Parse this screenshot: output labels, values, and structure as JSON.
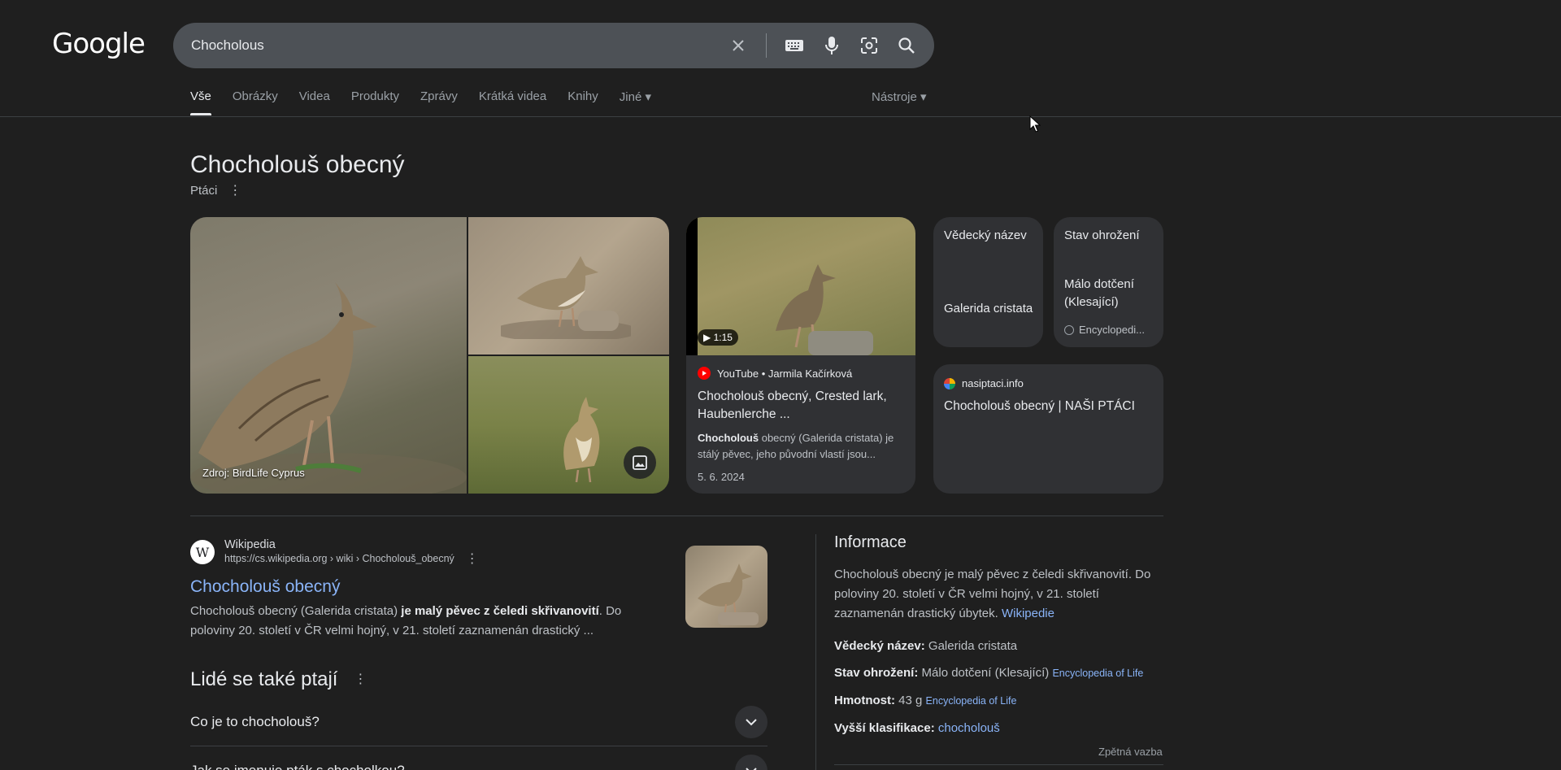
{
  "logo": "Google",
  "search": {
    "value": "Chocholous"
  },
  "tabs": [
    {
      "label": "Vše"
    },
    {
      "label": "Obrázky"
    },
    {
      "label": "Videa"
    },
    {
      "label": "Produkty"
    },
    {
      "label": "Zprávy"
    },
    {
      "label": "Krátká videa"
    },
    {
      "label": "Knihy"
    },
    {
      "label": "Jiné ▾"
    }
  ],
  "tools_label": "Nástroje ▾",
  "entity": {
    "title": "Chocholouš obecný",
    "category": "Ptáci"
  },
  "images": {
    "source": "Zdroj: BirdLife Cyprus"
  },
  "video": {
    "duration": "▶ 1:15",
    "channel": "YouTube • Jarmila Kačírková",
    "title": "Chocholouš obecný, Crested lark, Haubenlerche ...",
    "desc_bold": "Chocholouš",
    "desc_rest": " obecný (Galerida cristata) je stálý pěvec, jeho původní vlastí jsou...",
    "date": "5. 6. 2024"
  },
  "facts": {
    "scientific": {
      "label": "Vědecký název",
      "value": "Galerida cristata"
    },
    "status": {
      "label": "Stav ohrožení",
      "value": "Málo dotčení (Klesající)",
      "source": "Encyclopedi..."
    }
  },
  "site": {
    "domain": "nasiptaci.info",
    "title": "Chocholouš obecný | NAŠI PTÁCI"
  },
  "result": {
    "source_name": "Wikipedia",
    "url": "https://cs.wikipedia.org › wiki › Chocholouš_obecný",
    "title": "Chocholouš obecný",
    "snippet_a": "Chocholouš obecný (Galerida cristata) ",
    "snippet_bold": "je malý pěvec z čeledi skřivanovití",
    "snippet_b": ". Do poloviny 20. století v ČR velmi hojný, v 21. století zaznamenán drastický ..."
  },
  "paa": {
    "title": "Lidé se také ptají",
    "q1": "Co je to chocholouš?",
    "q2": "Jak se jmenuje pták s chocholkou?"
  },
  "info": {
    "title": "Informace",
    "desc": "Chocholouš obecný je malý pěvec z čeledi skřivanovití. Do poloviny 20. století v ČR velmi hojný, v 21. století zaznamenán drastický úbytek.",
    "desc_link": "Wikipedie",
    "sci_label": "Vědecký název:",
    "sci_value": " Galerida cristata",
    "status_label": "Stav ohrožení:",
    "status_value": " Málo dotčení (Klesající) ",
    "status_src": "Encyclopedia of Life",
    "mass_label": "Hmotnost:",
    "mass_value": " 43 g ",
    "mass_src": "Encyclopedia of Life",
    "class_label": "Vyšší klasifikace:",
    "class_value": "chocholouš",
    "feedback": "Zpětná vazba"
  },
  "icons": {
    "clear": "close-icon",
    "keyboard": "keyboard-icon",
    "mic": "microphone-icon",
    "lens": "camera-lens-icon",
    "search": "search-icon"
  }
}
